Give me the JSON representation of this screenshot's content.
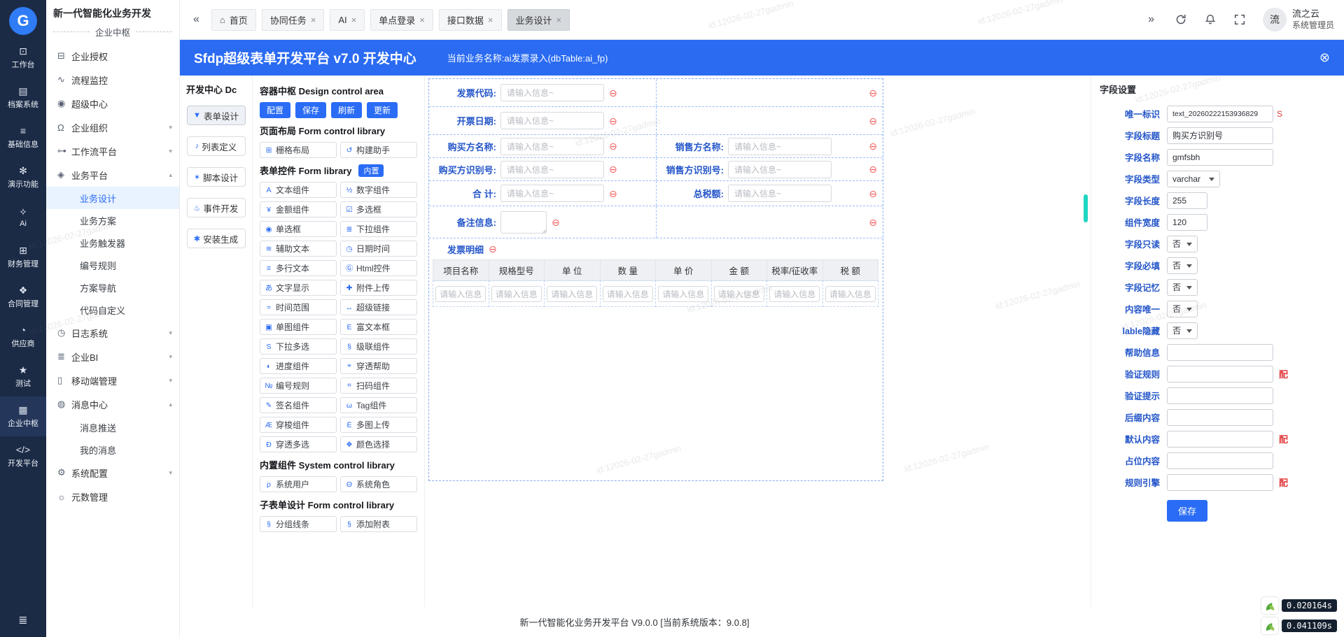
{
  "watermark": "id:12026-02-27gadmin",
  "icons": {
    "minus": "⊖",
    "close_circle": "⊗"
  },
  "rail": {
    "logo": "G",
    "items": [
      {
        "icon": "⊡",
        "label": "工作台"
      },
      {
        "icon": "▤",
        "label": "档案系统"
      },
      {
        "icon": "≡",
        "label": "基础信息"
      },
      {
        "icon": "✻",
        "label": "演示功能"
      },
      {
        "icon": "✧",
        "label": "Ai"
      },
      {
        "icon": "⊞",
        "label": "财务管理"
      },
      {
        "icon": "❖",
        "label": "合同管理"
      },
      {
        "icon": "◔",
        "label": "供应商"
      },
      {
        "icon": "★",
        "label": "测试"
      },
      {
        "icon": "▦",
        "label": "企业中枢",
        "state": "active"
      },
      {
        "icon": "</>",
        "label": "开发平台"
      }
    ],
    "bottom_icon": "≣"
  },
  "sidebar": {
    "title": "新一代智能化业务开发",
    "subtitle": "企业中枢",
    "menu": [
      {
        "icon": "⊟",
        "label": "企业授权",
        "kind": "top"
      },
      {
        "icon": "∿",
        "label": "流程监控",
        "kind": "top"
      },
      {
        "icon": "◉",
        "label": "超级中心",
        "kind": "top"
      },
      {
        "icon": "Ω",
        "label": "企业组织",
        "kind": "top",
        "chevron": "▾"
      },
      {
        "icon": "⊶",
        "label": "工作流平台",
        "kind": "top",
        "chevron": "▾"
      },
      {
        "icon": "◈",
        "label": "业务平台",
        "kind": "top",
        "chevron": "▴"
      },
      {
        "label": "业务设计",
        "kind": "sub",
        "state": "active"
      },
      {
        "label": "业务方案",
        "kind": "sub"
      },
      {
        "label": "业务触发器",
        "kind": "sub"
      },
      {
        "label": "编号规则",
        "kind": "sub"
      },
      {
        "label": "方案导航",
        "kind": "sub"
      },
      {
        "label": "代码自定义",
        "kind": "sub"
      },
      {
        "icon": "◷",
        "label": "日志系统",
        "kind": "top",
        "chevron": "▾"
      },
      {
        "icon": "≣",
        "label": "企业BI",
        "kind": "top",
        "chevron": "▾"
      },
      {
        "icon": "▯",
        "label": "移动端管理",
        "kind": "top",
        "chevron": "▾"
      },
      {
        "icon": "◍",
        "label": "消息中心",
        "kind": "top",
        "chevron": "▴"
      },
      {
        "label": "消息推送",
        "kind": "sub"
      },
      {
        "label": "我的消息",
        "kind": "sub"
      },
      {
        "icon": "⚙",
        "label": "系统配置",
        "kind": "top",
        "chevron": "▾"
      },
      {
        "icon": "☼",
        "label": "元数管理",
        "kind": "top"
      }
    ]
  },
  "tabbar": {
    "collapse_left": "«",
    "collapse_right": "»",
    "tabs": [
      {
        "icon": "⌂",
        "label": "首页"
      },
      {
        "label": "协同任务",
        "close": "×"
      },
      {
        "label": "AI",
        "close": "×"
      },
      {
        "label": "单点登录",
        "close": "×"
      },
      {
        "label": "接口数据",
        "close": "×"
      },
      {
        "label": "业务设计",
        "close": "×",
        "state": "active"
      }
    ],
    "user": {
      "avatar": "流",
      "name": "流之云",
      "role": "系统管理员"
    }
  },
  "bluebar": {
    "title": "Sfdp超级表单开发平台 v7.0 开发中心",
    "subtitle": "当前业务名称:ai发票录入(dbTable:ai_fp)"
  },
  "dev": {
    "title": "开发中心 Dc",
    "buttons": [
      {
        "icon": "▼",
        "label": "表单设计",
        "state": "active"
      },
      {
        "icon": "♪",
        "label": "列表定义"
      },
      {
        "icon": "✶",
        "label": "脚本设计"
      },
      {
        "icon": "♨",
        "label": "事件开发"
      },
      {
        "icon": "✱",
        "label": "安装生成"
      }
    ]
  },
  "lib": {
    "container_title": "容器中枢 Design control area",
    "actions": [
      "配置",
      "保存",
      "刷新",
      "更新"
    ],
    "layout_title": "页面布局 Form control library",
    "layout_items": [
      {
        "icon": "⊞",
        "label": "栅格布局"
      },
      {
        "icon": "↺",
        "label": "构建助手"
      }
    ],
    "form_title": "表单控件 Form library",
    "form_badge": "内置",
    "components": [
      {
        "icon": "A",
        "label": "文本组件"
      },
      {
        "icon": "½",
        "label": "数字组件"
      },
      {
        "icon": "¥",
        "label": "金额组件"
      },
      {
        "icon": "☑",
        "label": "多选框"
      },
      {
        "icon": "◉",
        "label": "单选框"
      },
      {
        "icon": "≣",
        "label": "下拉组件"
      },
      {
        "icon": "≋",
        "label": "辅助文本"
      },
      {
        "icon": "◷",
        "label": "日期时间"
      },
      {
        "icon": "≡",
        "label": "多行文本"
      },
      {
        "icon": "Ⓖ",
        "label": "Html控件"
      },
      {
        "icon": "あ",
        "label": "文字显示"
      },
      {
        "icon": "✚",
        "label": "附件上传"
      },
      {
        "icon": "≈",
        "label": "时间范围"
      },
      {
        "icon": "↔",
        "label": "超级链接"
      },
      {
        "icon": "▣",
        "label": "单图组件"
      },
      {
        "icon": "E",
        "label": "富文本框"
      },
      {
        "icon": "S",
        "label": "下拉多选"
      },
      {
        "icon": "§",
        "label": "级联组件"
      },
      {
        "icon": "◐",
        "label": "进度组件"
      },
      {
        "icon": "⌖",
        "label": "穿透帮助"
      },
      {
        "icon": "№",
        "label": "编号规则"
      },
      {
        "icon": "⌗",
        "label": "扫码组件"
      },
      {
        "icon": "✎",
        "label": "签名组件"
      },
      {
        "icon": "ω",
        "label": "Tag组件"
      },
      {
        "icon": "Æ",
        "label": "穿梭组件"
      },
      {
        "icon": "È",
        "label": "多图上传"
      },
      {
        "icon": "Đ",
        "label": "穿透多选"
      },
      {
        "icon": "❖",
        "label": "颜色选择"
      }
    ],
    "system_title": "内置组件 System control library",
    "system_items": [
      {
        "icon": "ρ",
        "label": "系统用户"
      },
      {
        "icon": "Θ",
        "label": "系统角色"
      }
    ],
    "subform_title": "子表单设计 Form control library",
    "subform_items": [
      {
        "icon": "§",
        "label": "分组线条"
      },
      {
        "icon": "§",
        "label": "添加附表"
      }
    ]
  },
  "canvas": {
    "placeholder": "请输入信息~",
    "fields": {
      "invoice_code": "发票代码:",
      "invoice_date": "开票日期:",
      "buyer_name": "购买方名称:",
      "seller_name": "销售方名称:",
      "buyer_tax_no": "购买方识别号:",
      "seller_tax_no": "销售方识别号:",
      "total": "合 计:",
      "total_tax": "总税额:",
      "remark": "备注信息:"
    },
    "detail_title": "发票明细",
    "columns": [
      "项目名称",
      "规格型号",
      "单 位",
      "数 量",
      "单 价",
      "金 额",
      "税率/征收率",
      "税 额"
    ],
    "cells": [
      "请输入信息~",
      "请输入信息~",
      "请输入信息~",
      "请输入信息~",
      "请输入信息~",
      "请输入信息~",
      "请输入信息~",
      "请输入信息~"
    ]
  },
  "panel": {
    "title": "字段设置",
    "fields": [
      {
        "label": "唯一标识",
        "value": "text_20260222153936829",
        "kind": "uid",
        "marker": "S"
      },
      {
        "label": "字段标题",
        "value": "购买方识别号",
        "kind": "wide"
      },
      {
        "label": "字段名称",
        "value": "gmfsbh",
        "kind": "wide"
      },
      {
        "label": "字段类型",
        "value": "varchar",
        "kind": "select"
      },
      {
        "label": "字段长度",
        "value": "255",
        "kind": "short"
      },
      {
        "label": "组件宽度",
        "value": "120",
        "kind": "short"
      },
      {
        "label": "字段只读",
        "value": "否",
        "kind": "tiny"
      },
      {
        "label": "字段必填",
        "value": "否",
        "kind": "tiny"
      },
      {
        "label": "字段记忆",
        "value": "否",
        "kind": "tiny"
      },
      {
        "label": "内容唯一",
        "value": "否",
        "kind": "tiny"
      },
      {
        "label": "lable隐藏",
        "value": "否",
        "kind": "tiny"
      },
      {
        "label": "帮助信息",
        "value": "",
        "kind": "wide"
      },
      {
        "label": "验证规则",
        "value": "",
        "kind": "wide",
        "config": "配"
      },
      {
        "label": "验证提示",
        "value": "",
        "kind": "wide"
      },
      {
        "label": "后缀内容",
        "value": "",
        "kind": "wide"
      },
      {
        "label": "默认内容",
        "value": "",
        "kind": "wide",
        "config": "配"
      },
      {
        "label": "占位内容",
        "value": "",
        "kind": "wide"
      },
      {
        "label": "规则引擎",
        "value": "",
        "kind": "wide",
        "config": "配"
      }
    ],
    "save_label": "保存"
  },
  "footer": {
    "text": "新一代智能化业务开发平台 V9.0.0 [当前系统版本：9.0.8]"
  },
  "perf": {
    "values": [
      "0.020164s",
      "0.041109s"
    ]
  }
}
